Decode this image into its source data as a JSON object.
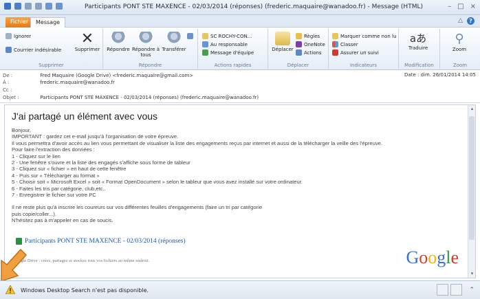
{
  "window": {
    "title": "Participants PONT STE MAXENCE - 02/03/2014 (réponses) (frederic.maquaire@wanadoo.fr) - Message (HTML)",
    "minimize": "–",
    "maximize": "□",
    "close": "×"
  },
  "tabs": {
    "fichier": "Fichier",
    "message": "Message",
    "collapse": "△",
    "help": "?"
  },
  "ribbon": {
    "supprimer": {
      "ignorer": "Ignorer",
      "courrier": "Courrier indésirable",
      "supprimer": "Supprimer",
      "label": "Supprimer"
    },
    "repondre": {
      "repondre": "Répondre",
      "repondre_tous": "Répondre à tous",
      "transferer": "Transférer",
      "label": "Répondre"
    },
    "actions_rapides": {
      "item1": "SC ROCHY-CON...",
      "item2": "Au responsable",
      "item3": "Message d'équipe",
      "label": "Actions rapides"
    },
    "deplacer": {
      "deplacer": "Déplacer",
      "regles": "Règles",
      "onenote": "OneNote",
      "actions": "Actions",
      "label": "Déplacer"
    },
    "indicateurs": {
      "marquer": "Marquer comme non lu",
      "classer": "Classer",
      "assurer": "Assurer un suivi",
      "label": "Indicateurs"
    },
    "modification": {
      "traduire": "Traduire",
      "label": "Modification"
    },
    "zoom": {
      "zoom": "Zoom",
      "label": "Zoom"
    }
  },
  "headers": {
    "de_label": "De :",
    "de_value": "Fred Maquaire (Google Drive) <frederic.maquaire@gmail.com>",
    "a_label": "À :",
    "a_value": "frederic.maquaire@wanadoo.fr",
    "cc_label": "Cc :",
    "cc_value": "",
    "objet_label": "Objet :",
    "objet_value": "Participants PONT STE MAXENCE - 02/03/2014 (réponses) (frederic.maquaire@wanadoo.fr)",
    "date": "Date : dim. 26/01/2014 14:05"
  },
  "message": {
    "heading": "J'ai partagé un élément avec vous",
    "lines": [
      "Bonjour,",
      "IMPORTANT : gardez cet e-mail jusqu'à l'organisation de votre épreuve.",
      "Il vous permettra d'avoir accès au lien vous permettant de visualiser la liste des engagements reçus par internet et aussi de la télécharger la veille des l'épreuve.",
      "Pour faire l'extraction des données :",
      "1 - Cliquez sur le lien",
      "2 - Une fenêtre s'ouvre et la liste des engagés s'affiche sous forme de tableur",
      "3 - Cliquez sur « fichier » en haut de cette fenêtre",
      "4 - Puis sur « Télécharger au format »",
      "5 - Choisir soit « Microsoft Excel » soit « Format OpenDocument » selon le tableur que vous avez installé sur votre ordinateur.",
      "6 - Faites les tris par catégorie, club,etc..",
      "7 - Enregistrer le fichier sur votre PC",
      "",
      "Il ne reste plus qu'à inscrire les coureurs sur vos différentes feuilles d'engagements (faire un tri par catégorie",
      "puis copie/coller...).",
      "N'hésitez pas à m'appeler en cas de soucis."
    ],
    "file_link": "Participants PONT STE MAXENCE - 02/03/2014 (réponses)",
    "drive_footer": "ogle Drive : créez, partagez et stockez tous vos fichiers au même endroit.",
    "google_logo": [
      "G",
      "o",
      "o",
      "g",
      "l",
      "e"
    ],
    "google_colors": [
      "#3b6fd4",
      "#d93a2b",
      "#f1b400",
      "#3b6fd4",
      "#2f9e44",
      "#d93a2b"
    ]
  },
  "status": {
    "text": "Windows Desktop Search n'est pas disponible."
  }
}
